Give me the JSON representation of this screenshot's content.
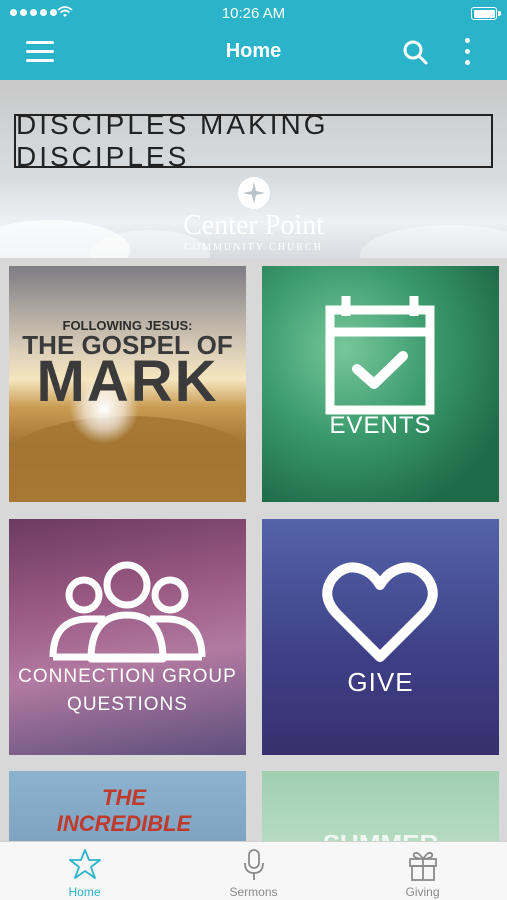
{
  "status_bar": {
    "time": "10:26 AM"
  },
  "nav": {
    "title": "Home"
  },
  "hero": {
    "headline": "DISCIPLES MAKING DISCIPLES",
    "church_name": "Center Point",
    "church_subtitle": "COMMUNITY CHURCH"
  },
  "tiles": [
    {
      "subtitle": "FOLLOWING JESUS:",
      "title": "THE GOSPEL OF",
      "big": "MARK",
      "icon": "sermon-series-image"
    },
    {
      "label": "EVENTS",
      "icon": "calendar-check-icon"
    },
    {
      "label_line1": "CONNECTION GROUP",
      "label_line2": "QUESTIONS",
      "icon": "group-people-icon"
    },
    {
      "label": "GIVE",
      "icon": "heart-outline-icon"
    },
    {
      "partial_text": "THE INCREDIBLE",
      "icon": "kids-series-image"
    },
    {
      "partial_text": "SUMMER",
      "icon": "summer-series-image"
    }
  ],
  "tabbar": {
    "items": [
      {
        "label": "Home",
        "icon": "star-icon",
        "active": true
      },
      {
        "label": "Sermons",
        "icon": "microphone-icon",
        "active": false
      },
      {
        "label": "Giving",
        "icon": "gift-icon",
        "active": false
      }
    ]
  },
  "colors": {
    "accent": "#2bb3c9",
    "inactive": "#8a8a8a"
  }
}
